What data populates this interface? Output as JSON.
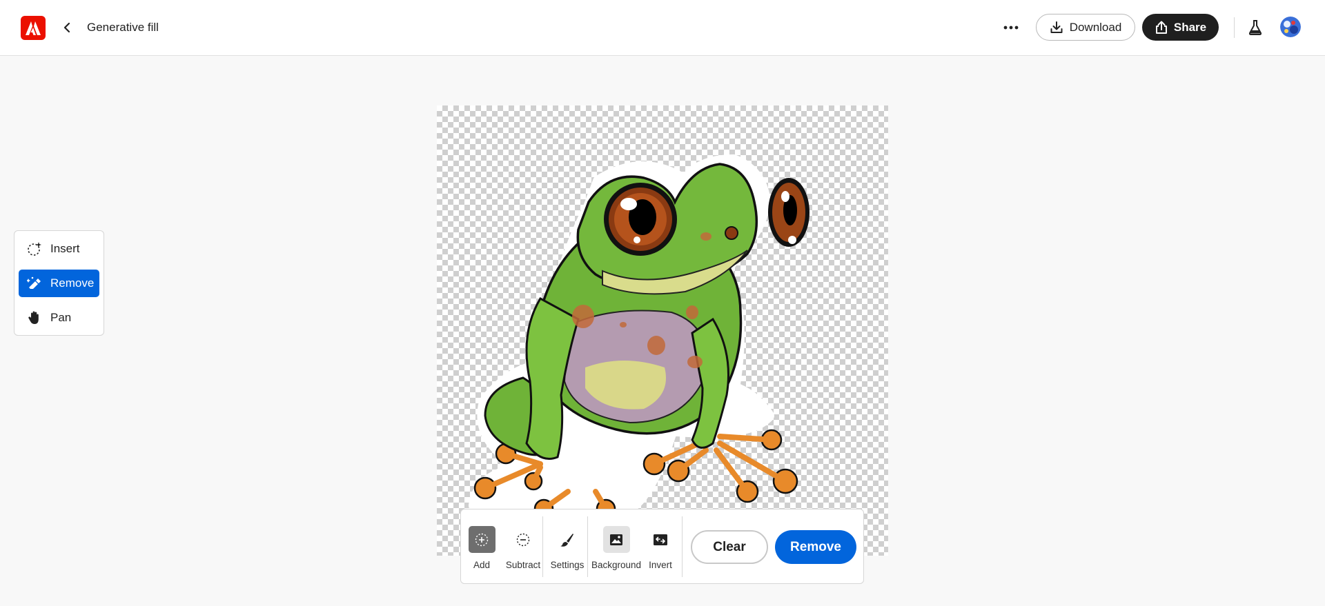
{
  "header": {
    "title": "Generative fill",
    "download_label": "Download",
    "share_label": "Share"
  },
  "tools": [
    {
      "label": "Insert",
      "icon": "insert-sparkle-icon",
      "active": false
    },
    {
      "label": "Remove",
      "icon": "remove-eraser-icon",
      "active": true
    },
    {
      "label": "Pan",
      "icon": "hand-icon",
      "active": false
    }
  ],
  "toolbar": {
    "add_label": "Add",
    "subtract_label": "Subtract",
    "settings_label": "Settings",
    "background_label": "Background",
    "invert_label": "Invert",
    "clear_label": "Clear",
    "remove_label": "Remove"
  },
  "colors": {
    "brand_red": "#eb1000",
    "accent_blue": "#0265dc",
    "share_dark": "#1f1f1f"
  }
}
